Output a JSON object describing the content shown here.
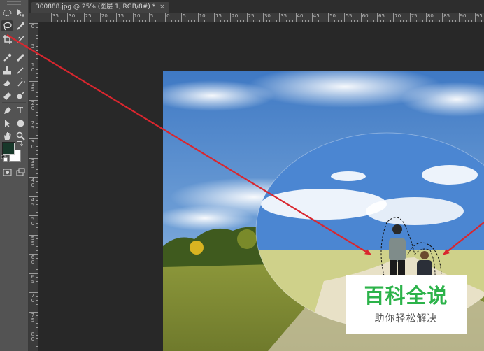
{
  "document_tab": {
    "title": "300888.jpg @ 25% (图层 1, RGB/8#) *",
    "close_glyph": "×"
  },
  "rulers": {
    "horizontal_labels": [
      "35",
      "30",
      "25",
      "20",
      "15",
      "10",
      "5",
      "0",
      "5",
      "10",
      "15",
      "20",
      "25",
      "30",
      "35",
      "40",
      "45",
      "50",
      "55",
      "60",
      "65",
      "70",
      "75",
      "80",
      "85",
      "90",
      "95"
    ],
    "vertical_labels": [
      "0",
      "5",
      "1 0",
      "1 5",
      "2 0",
      "2 5",
      "3 0",
      "3 5",
      "4 0",
      "4 5",
      "5 0",
      "5 5",
      "6 0",
      "6 5",
      "7 0",
      "7 5",
      "8 0"
    ]
  },
  "toolbar": {
    "tools": [
      {
        "name": "rect-marquee-icon"
      },
      {
        "name": "move-icon"
      },
      {
        "name": "lasso-icon",
        "active": true
      },
      {
        "name": "quick-select-icon"
      },
      {
        "name": "crop-icon"
      },
      {
        "name": "slice-icon"
      },
      {
        "name": "eyedropper-icon"
      },
      {
        "name": "healing-brush-icon"
      },
      {
        "name": "clone-stamp-icon"
      },
      {
        "name": "brush-icon"
      },
      {
        "name": "history-brush-icon"
      },
      {
        "name": "eraser-icon"
      },
      {
        "name": "gradient-icon"
      },
      {
        "name": "blur-icon"
      },
      {
        "name": "pen-icon"
      },
      {
        "name": "type-icon"
      },
      {
        "name": "path-select-icon"
      },
      {
        "name": "shape-icon"
      },
      {
        "name": "hand-icon"
      },
      {
        "name": "zoom-icon"
      }
    ],
    "type_glyph": "T",
    "foreground_color": "#17382a",
    "background_color": "#ffffff"
  },
  "watermark": {
    "title": "百科全说",
    "subtitle": "助你轻松解决",
    "color": "#2cb34a"
  },
  "annotation_color": "#d9262e"
}
